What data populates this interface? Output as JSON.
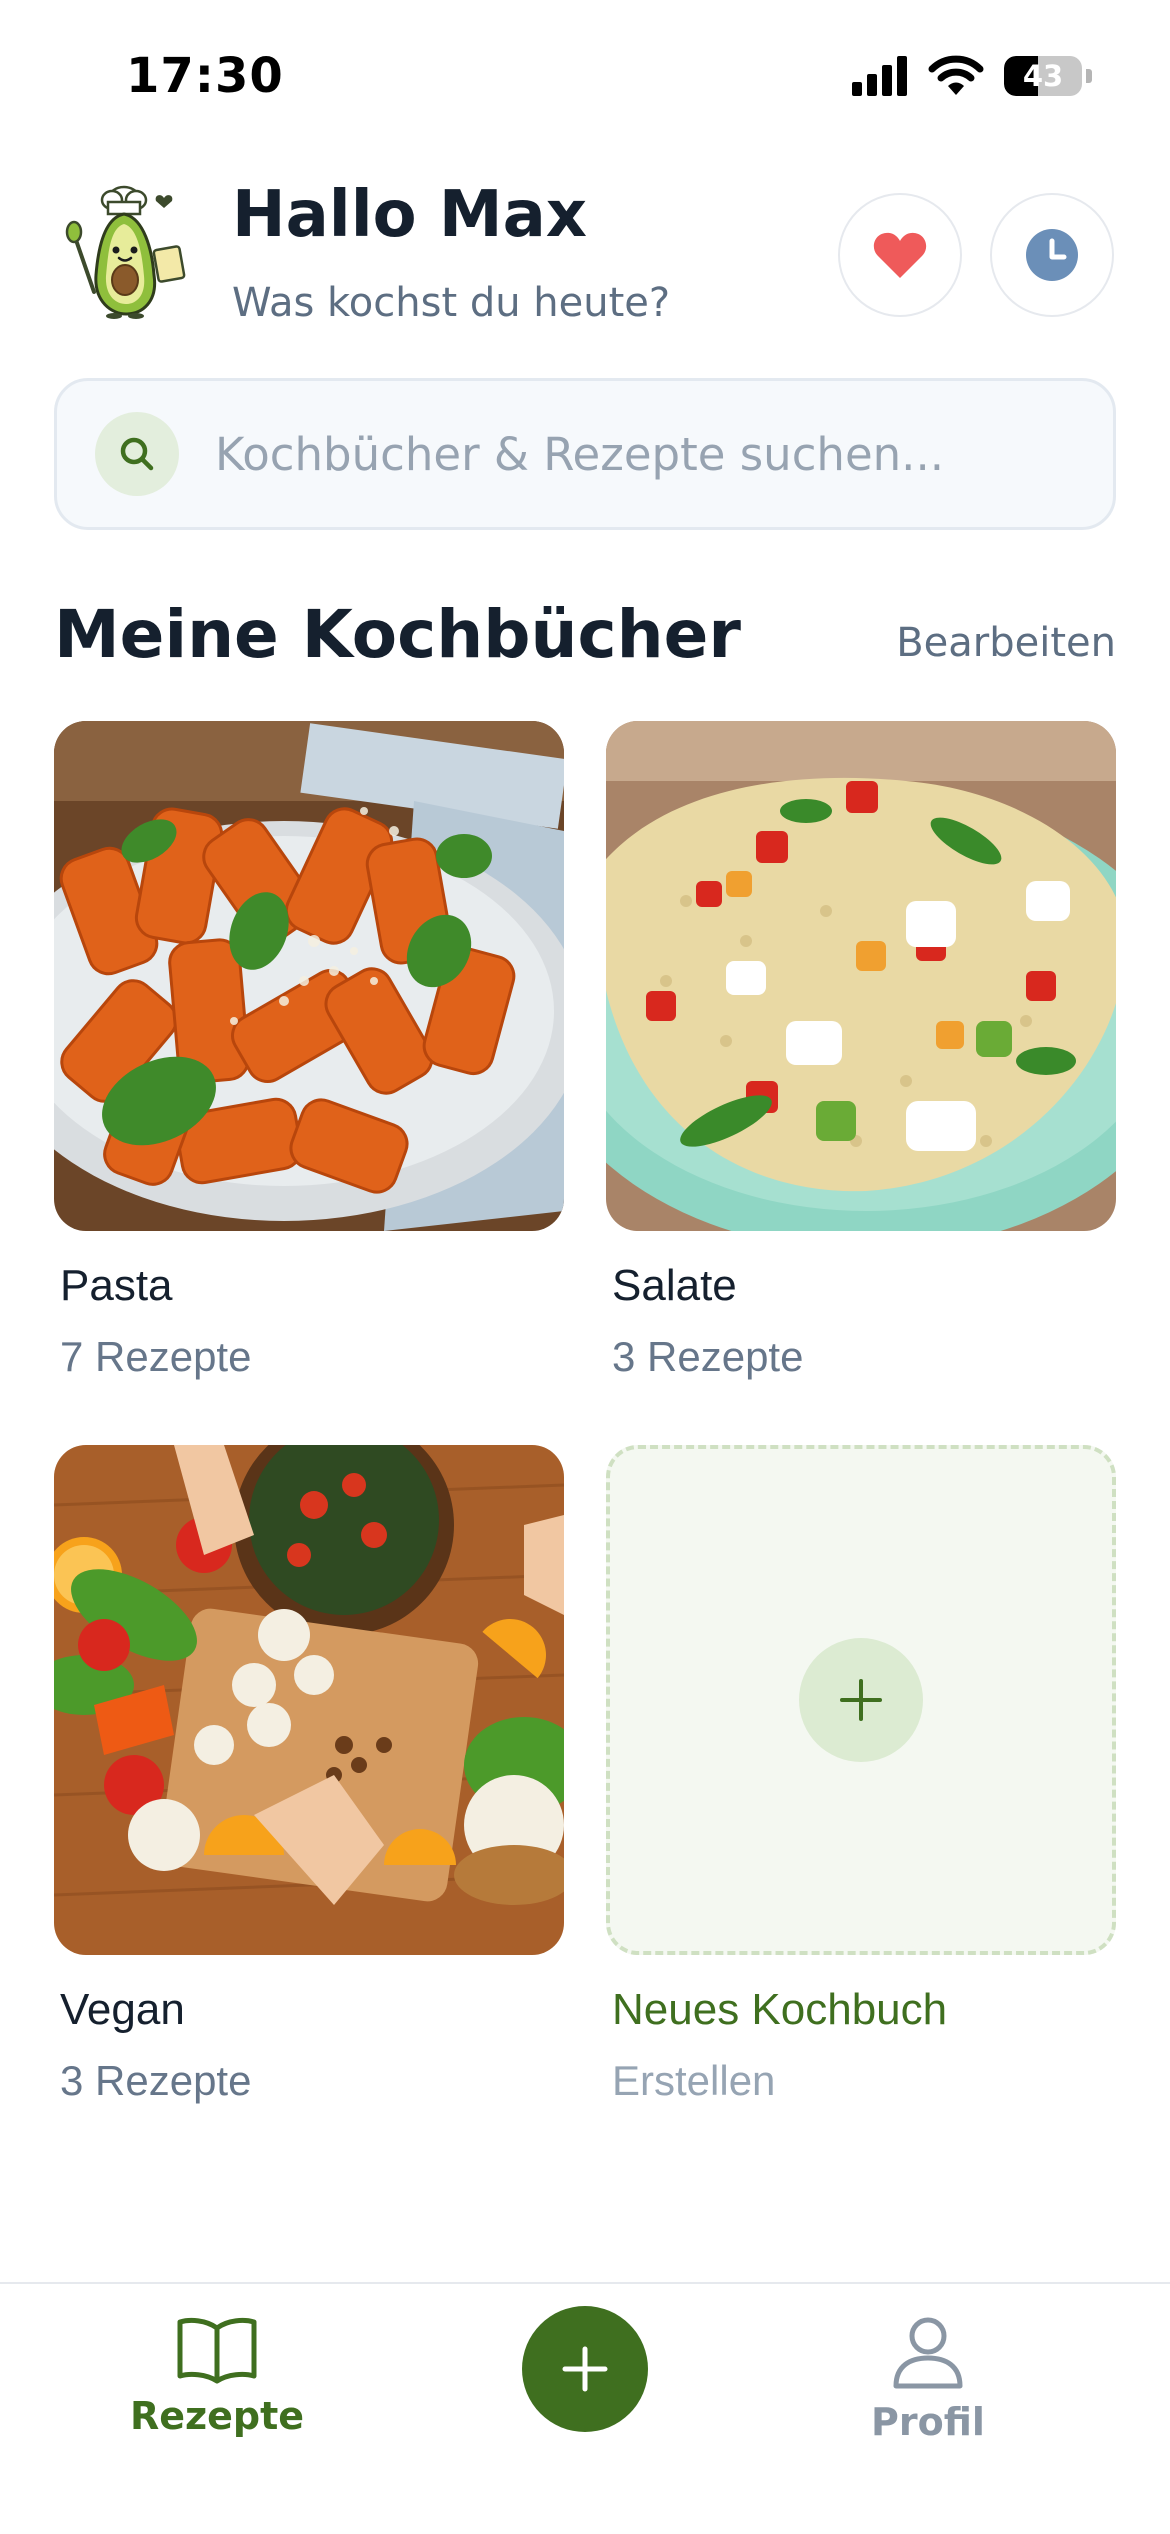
{
  "status_bar": {
    "time": "17:30",
    "battery": "43",
    "battery_level": 0.43
  },
  "header": {
    "greeting": "Hallo Max",
    "subtitle": "Was kochst du heute?",
    "mascot_icon": "avocado-chef-mascot",
    "favorites_icon": "heart-icon",
    "history_icon": "clock-icon"
  },
  "search": {
    "placeholder": "Kochbücher & Rezepte suchen..."
  },
  "section": {
    "title": "Meine Kochbücher",
    "edit_label": "Bearbeiten"
  },
  "cookbooks": [
    {
      "title": "Pasta",
      "count": "7 Rezepte",
      "image": "rigatoni-tomato-basil-photo"
    },
    {
      "title": "Salate",
      "count": "3 Rezepte",
      "image": "couscous-salad-photo"
    },
    {
      "title": "Vegan",
      "count": "3 Rezepte",
      "image": "vegetables-cutting-board-photo"
    }
  ],
  "new_cookbook": {
    "title": "Neues Kochbuch",
    "subtitle": "Erstellen"
  },
  "bottom_nav": {
    "recipes_label": "Rezepte",
    "add_icon": "plus-icon",
    "profile_label": "Profil"
  },
  "colors": {
    "accent": "#3f6f1f",
    "heart": "#ef5a5a",
    "clock": "#6b8fb8",
    "text": "#15202e",
    "muted": "#5d6e82"
  }
}
